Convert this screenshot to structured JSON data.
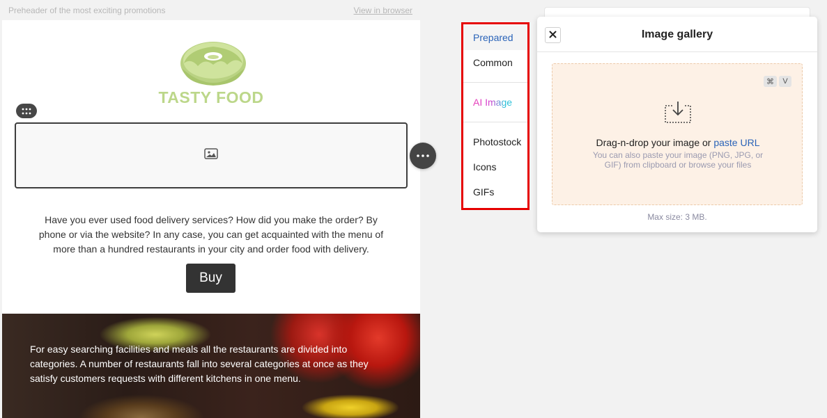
{
  "preheader": {
    "text": "Preheader of the most exciting promotions",
    "view_link": "View in browser"
  },
  "email": {
    "logo_text": "TASTY FOOD",
    "body_text": "Have you ever used food delivery services? How did you make the order? By phone or via the website? In any case, you can get acquainted with the menu of more than a hundred restaurants in your city and order food with delivery.",
    "buy_label": "Buy",
    "veg_text": "For easy searching facilities and meals all the restaurants are divided into categories. A number of restaurants fall into several categories at once as they satisfy customers requests with different kitchens in one menu."
  },
  "source_menu": {
    "items": [
      {
        "label": "Prepared",
        "active": true
      },
      {
        "label": "Common",
        "active": false
      },
      {
        "label": "AI Image",
        "active": false
      },
      {
        "label": "Photostock",
        "active": false
      },
      {
        "label": "Icons",
        "active": false
      },
      {
        "label": "GIFs",
        "active": false
      }
    ]
  },
  "gallery": {
    "title": "Image gallery",
    "shortcut_keys": [
      "⌘",
      "V"
    ],
    "drop_text": "Drag-n-drop your image or",
    "paste_link": "paste URL",
    "hint": "You can also paste your image (PNG, JPG, or GIF) from clipboard or browse your files",
    "max_size": "Max size: 3 MB."
  },
  "colors": {
    "accent_blue": "#2a63b8",
    "highlight_red": "#e60000",
    "logo_green": "#bcd78a",
    "dropzone_bg": "#fdf1e6",
    "button_dark": "#333333"
  },
  "icons": [
    "close-icon",
    "image-placeholder-icon",
    "drag-handle-icon",
    "more-options-icon",
    "download-icon",
    "donut-logo-icon"
  ]
}
